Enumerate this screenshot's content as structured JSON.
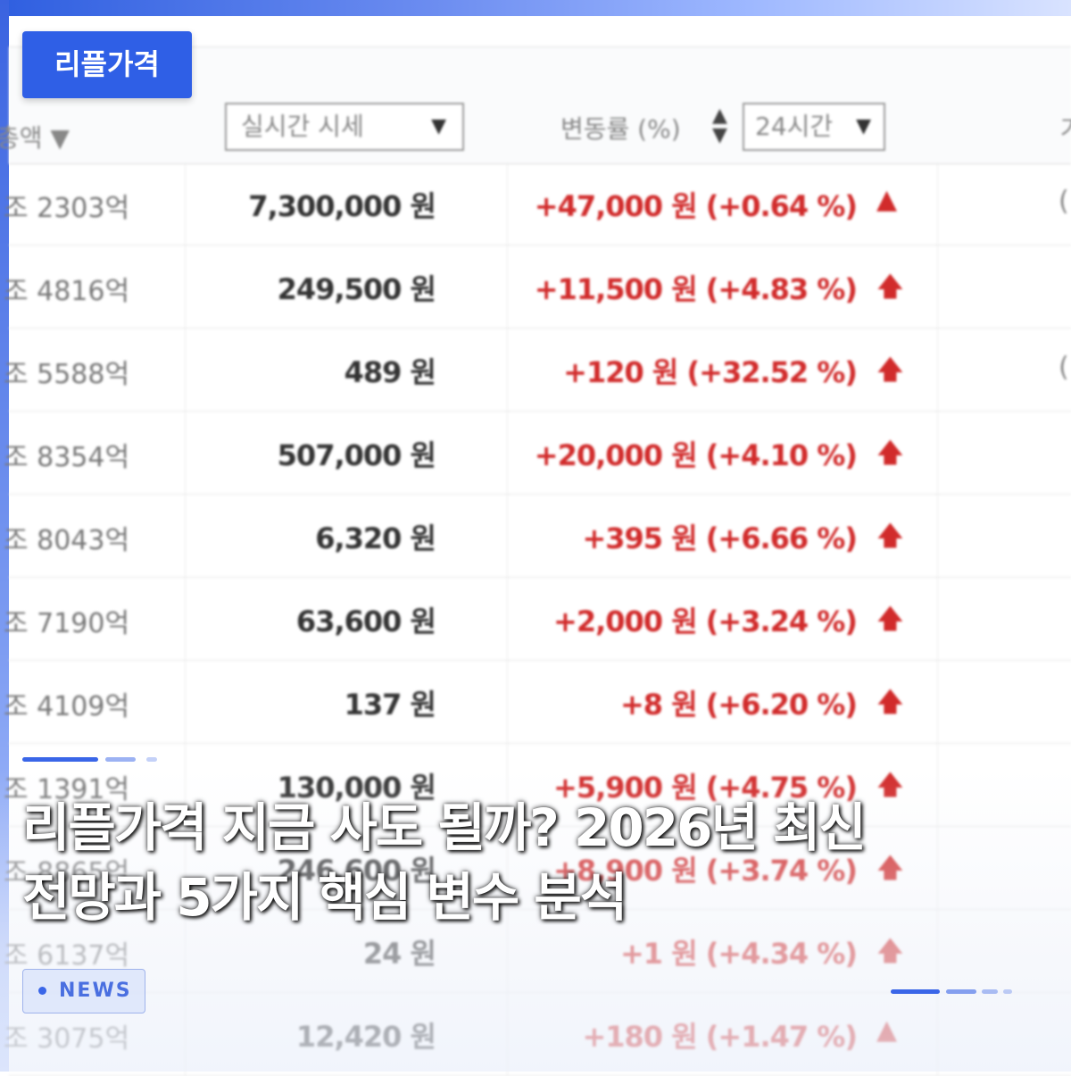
{
  "tag_label": "리플가격",
  "table": {
    "header": {
      "sort_label": "총액 ▼",
      "view_select": "실시간 시세",
      "change_label": "변동률 (%)",
      "period_select": "24시간",
      "right_cut": "거"
    },
    "rows": [
      {
        "cap": "조 2303억",
        "price": "7,300,000 원",
        "change": "+47,000 원 (+0.64 %)",
        "icon": "▲",
        "right": "("
      },
      {
        "cap": "조 4816억",
        "price": "249,500 원",
        "change": "+11,500 원 (+4.83 %)",
        "icon": "🡅",
        "right": ""
      },
      {
        "cap": "조 5588억",
        "price": "489 원",
        "change": "+120 원 (+32.52 %)",
        "icon": "🡅",
        "right": "("
      },
      {
        "cap": "조 8354억",
        "price": "507,000 원",
        "change": "+20,000 원 (+4.10 %)",
        "icon": "🡅",
        "right": ""
      },
      {
        "cap": "조 8043억",
        "price": "6,320 원",
        "change": "+395 원 (+6.66 %)",
        "icon": "🡅",
        "right": ""
      },
      {
        "cap": "조 7190억",
        "price": "63,600 원",
        "change": "+2,000 원 (+3.24 %)",
        "icon": "🡅",
        "right": ""
      },
      {
        "cap": "조 4109억",
        "price": "137 원",
        "change": "+8 원 (+6.20 %)",
        "icon": "🡅",
        "right": ""
      },
      {
        "cap": "조 1391억",
        "price": "130,000 원",
        "change": "+5,900 원 (+4.75 %)",
        "icon": "🡅",
        "right": ""
      },
      {
        "cap": "조 8865억",
        "price": "246,600 원",
        "change": "+8,900 원 (+3.74 %)",
        "icon": "🡅",
        "right": ""
      },
      {
        "cap": "조 6137억",
        "price": "24 원",
        "change": "+1 원 (+4.34 %)",
        "icon": "🡅",
        "right": ""
      },
      {
        "cap": "조 3075억",
        "price": "12,420 원",
        "change": "+180 원 (+1.47 %)",
        "icon": "▲",
        "right": ""
      }
    ]
  },
  "headline": {
    "line1": "리플가격 지금 사도 될까? 2026년 최신",
    "line2": "전망과 5가지 핵심 변수 분석"
  },
  "news_badge": "NEWS",
  "colors": {
    "accent": "#2f5fe6",
    "up": "#d12b2b"
  }
}
